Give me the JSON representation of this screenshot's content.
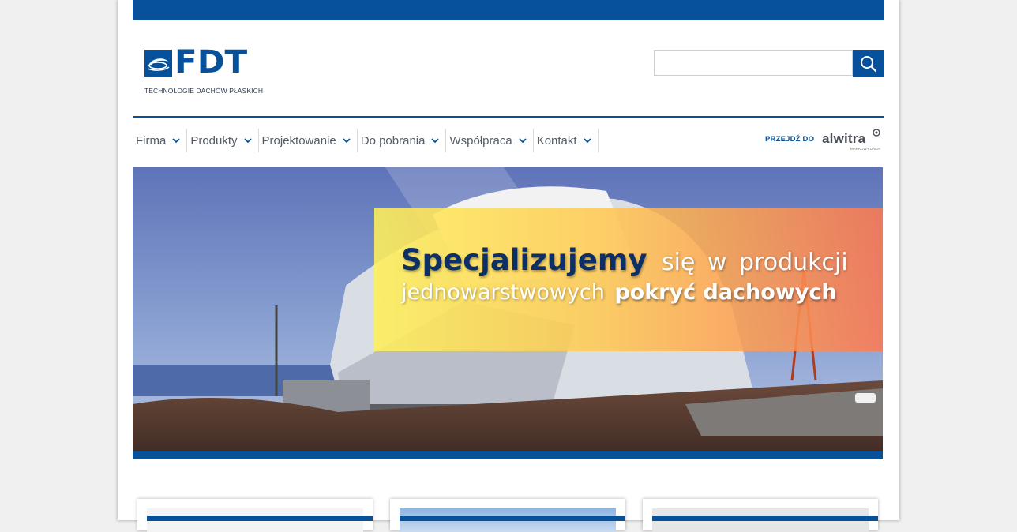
{
  "brand": {
    "logo_text": "FDT",
    "tagline": "TECHNOLOGIE DACHÓW PŁASKICH",
    "color_primary": "#06519a"
  },
  "search": {
    "value": "",
    "placeholder": "",
    "icon": "search-icon"
  },
  "nav": {
    "items": [
      {
        "label": "Firma",
        "icon": "chevron-down-icon"
      },
      {
        "label": "Produkty",
        "icon": "chevron-down-icon"
      },
      {
        "label": "Projektowanie",
        "icon": "chevron-down-icon"
      },
      {
        "label": "Do pobrania",
        "icon": "chevron-down-icon"
      },
      {
        "label": "Współpraca",
        "icon": "chevron-down-icon"
      },
      {
        "label": "Kontakt",
        "icon": "chevron-down-icon"
      }
    ],
    "goto_label": "PRZEJDŹ DO",
    "partner": {
      "name": "alwitra",
      "sub": "MARKOWY DACH"
    }
  },
  "hero": {
    "line1_strong": "Specjalizujemy",
    "line1_light": "się w produkcji",
    "line2_light": "jednowarstwowych",
    "line2_strong": "pokryć dachowych"
  },
  "cards": [
    {
      "name": "card-1"
    },
    {
      "name": "card-2"
    },
    {
      "name": "card-3"
    }
  ]
}
